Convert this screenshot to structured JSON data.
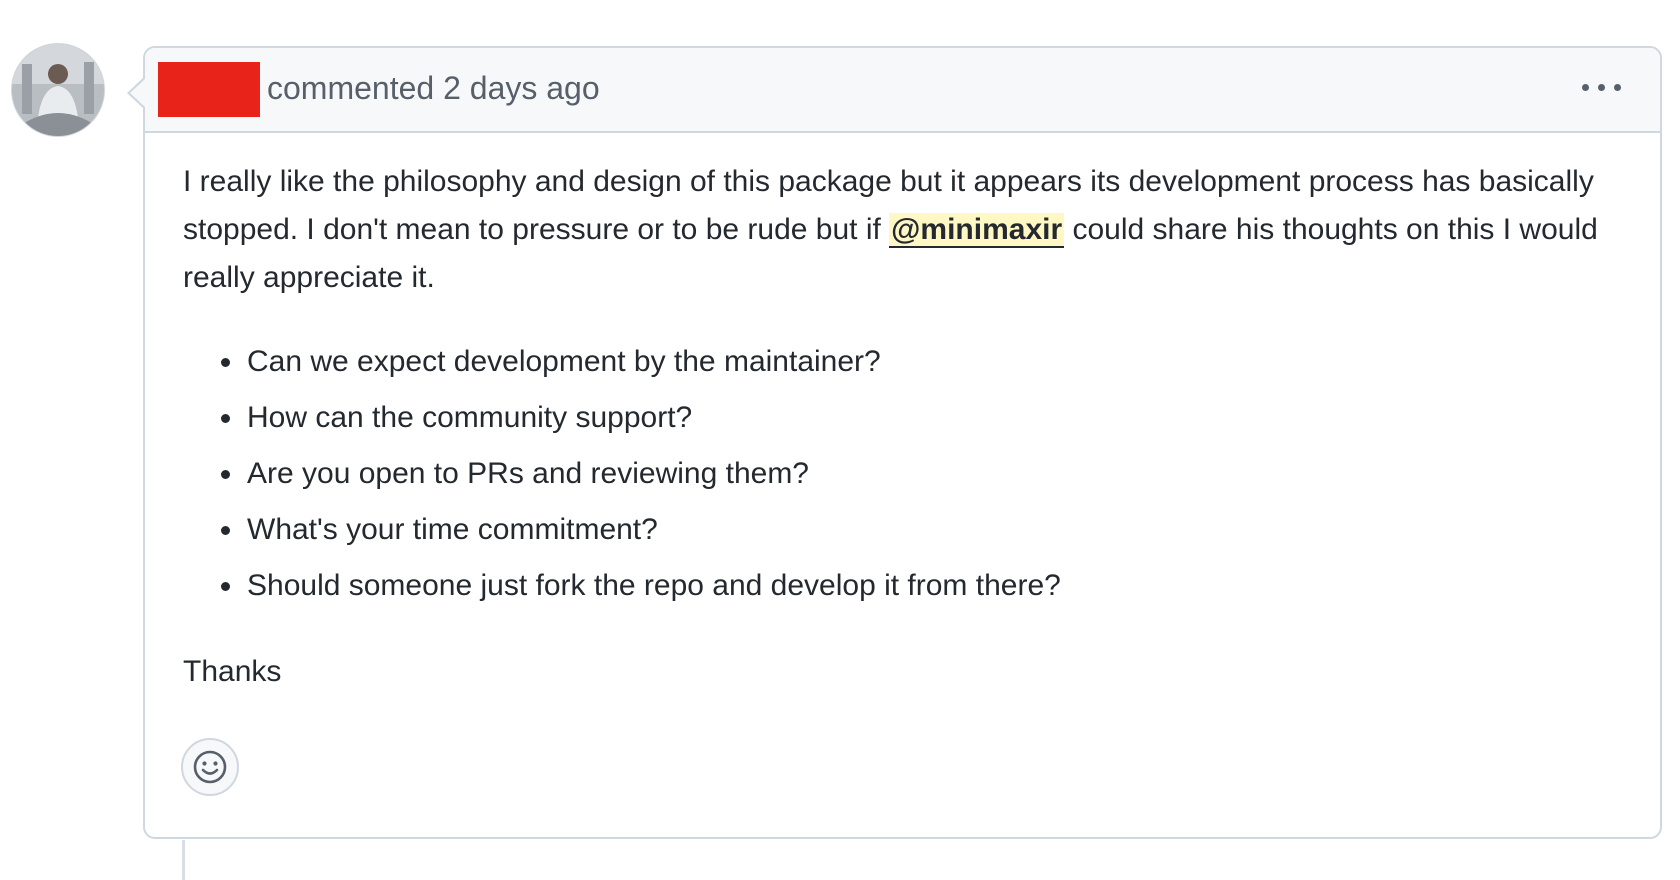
{
  "comment": {
    "author_redacted": true,
    "header_text": "commented 2 days ago",
    "body": {
      "line1_before_mention": "I really like the philosophy and design of this package but it appears its development process has basically stopped. I don't mean to pressure or to be rude but if ",
      "mention": "@minimaxir",
      "line1_after_mention": " could share his thoughts on this I would really appreciate it.",
      "questions": [
        "Can we expect development by the maintainer?",
        "How can the community support?",
        "Are you open to PRs and reviewing them?",
        "What's your time commitment?",
        "Should someone just fork the repo and develop it from there?"
      ],
      "closing": "Thanks"
    }
  },
  "icons": {
    "avatar": "user-avatar",
    "more_options": "kebab-horizontal-icon",
    "add_reaction": "smiley-icon"
  },
  "colors": {
    "redaction": "#e8231a",
    "mention_highlight": "#fff8c5",
    "header_bg": "#f6f8fa",
    "border": "#d0d7de"
  }
}
